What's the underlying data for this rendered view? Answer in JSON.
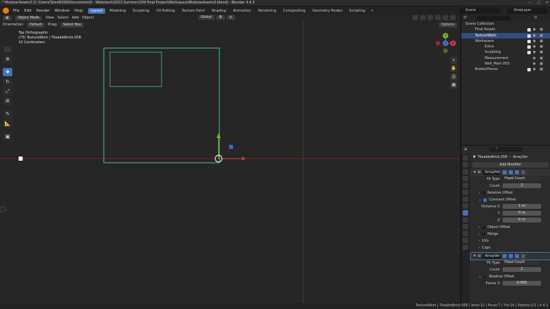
{
  "window": {
    "title": "* ModularAssets3 [C:\\Users\\TylerW309\\Documents\\0 - Webstech\\2023 Summer\\209 Final Project\\Workspace\\ModularAssets3.blend] - Blender 4.4.3",
    "controls": [
      "—",
      "□",
      "✕"
    ]
  },
  "menubar": {
    "menus": [
      "File",
      "Edit",
      "Render",
      "Window",
      "Help"
    ],
    "workspaces": [
      "Layout",
      "Modeling",
      "Sculpting",
      "UV Editing",
      "Texture Paint",
      "Shading",
      "Animation",
      "Rendering",
      "Compositing",
      "Geometry Nodes",
      "Scripting"
    ],
    "active_workspace": "Layout",
    "scene": "Scene",
    "view_layer": "ViewLayer"
  },
  "viewport": {
    "mode": "Object Mode",
    "menus": [
      "View",
      "Select",
      "Add",
      "Object"
    ],
    "transform": "Global",
    "orientation_label": "Orientation:",
    "orientation_value": "Default",
    "drag_label": "Drag:",
    "drag_value": "Select Box",
    "options": "Options",
    "info_line1": "Top Orthographic",
    "info_line2": "(73) TextureWork | TileableBrick.058",
    "info_line3": "10 Centimeters",
    "axis_labels": {
      "x": "X",
      "y": "Y",
      "z": "Z"
    }
  },
  "outliner": {
    "title": "Scene Collection",
    "items": [
      {
        "name": "Final Assets",
        "indent": 1,
        "selected": false
      },
      {
        "name": "TextureWork",
        "indent": 1,
        "selected": true
      },
      {
        "name": "Workspace",
        "indent": 1,
        "selected": false
      },
      {
        "name": "Extra",
        "indent": 2,
        "selected": false
      },
      {
        "name": "Sculpting",
        "indent": 2,
        "selected": false
      },
      {
        "name": "Measurement",
        "indent": 2,
        "selected": false
      },
      {
        "name": "Wall_Main.003",
        "indent": 2,
        "selected": false
      },
      {
        "name": "BrokenPieces",
        "indent": 1,
        "selected": false
      }
    ]
  },
  "properties": {
    "object_name": "TileableBrick.058",
    "modifier_crumb": "ArrayVer",
    "add_modifier": "Add Modifier",
    "mod1": {
      "name": "ArrayHor",
      "fit_type_label": "Fit Type",
      "fit_type": "Fixed Count",
      "count_label": "Count",
      "count": "2",
      "relative_offset": "Relative Offset",
      "constant_offset": "Constant Offset",
      "distance_x_label": "Distance X",
      "distance_x": "1 m",
      "y_label": "Y",
      "y": "0 m",
      "z_label": "Z",
      "z": "0 m",
      "object_offset": "Object Offset",
      "merge": "Merge",
      "uvs": "UVs",
      "caps": "Caps"
    },
    "mod2": {
      "name": "ArrayVer",
      "fit_type_label": "Fit Type",
      "fit_type": "Fixed Count",
      "count_label": "Count",
      "count": "2",
      "relative_offset": "Relative Offset",
      "factor_x_label": "Factor X",
      "factor_x": "0.000"
    }
  },
  "statusbar": {
    "text": "TextureWork | TileableBrick.058 | Verts:12 | Faces:7 | Tris:14 | Objects:1/1 | 4.4.3"
  },
  "colors": {
    "accent": "#4772b3",
    "selection_outline": "#5ad1b4",
    "x_axis": "#b3343f",
    "y_axis": "#5f8f2f"
  }
}
